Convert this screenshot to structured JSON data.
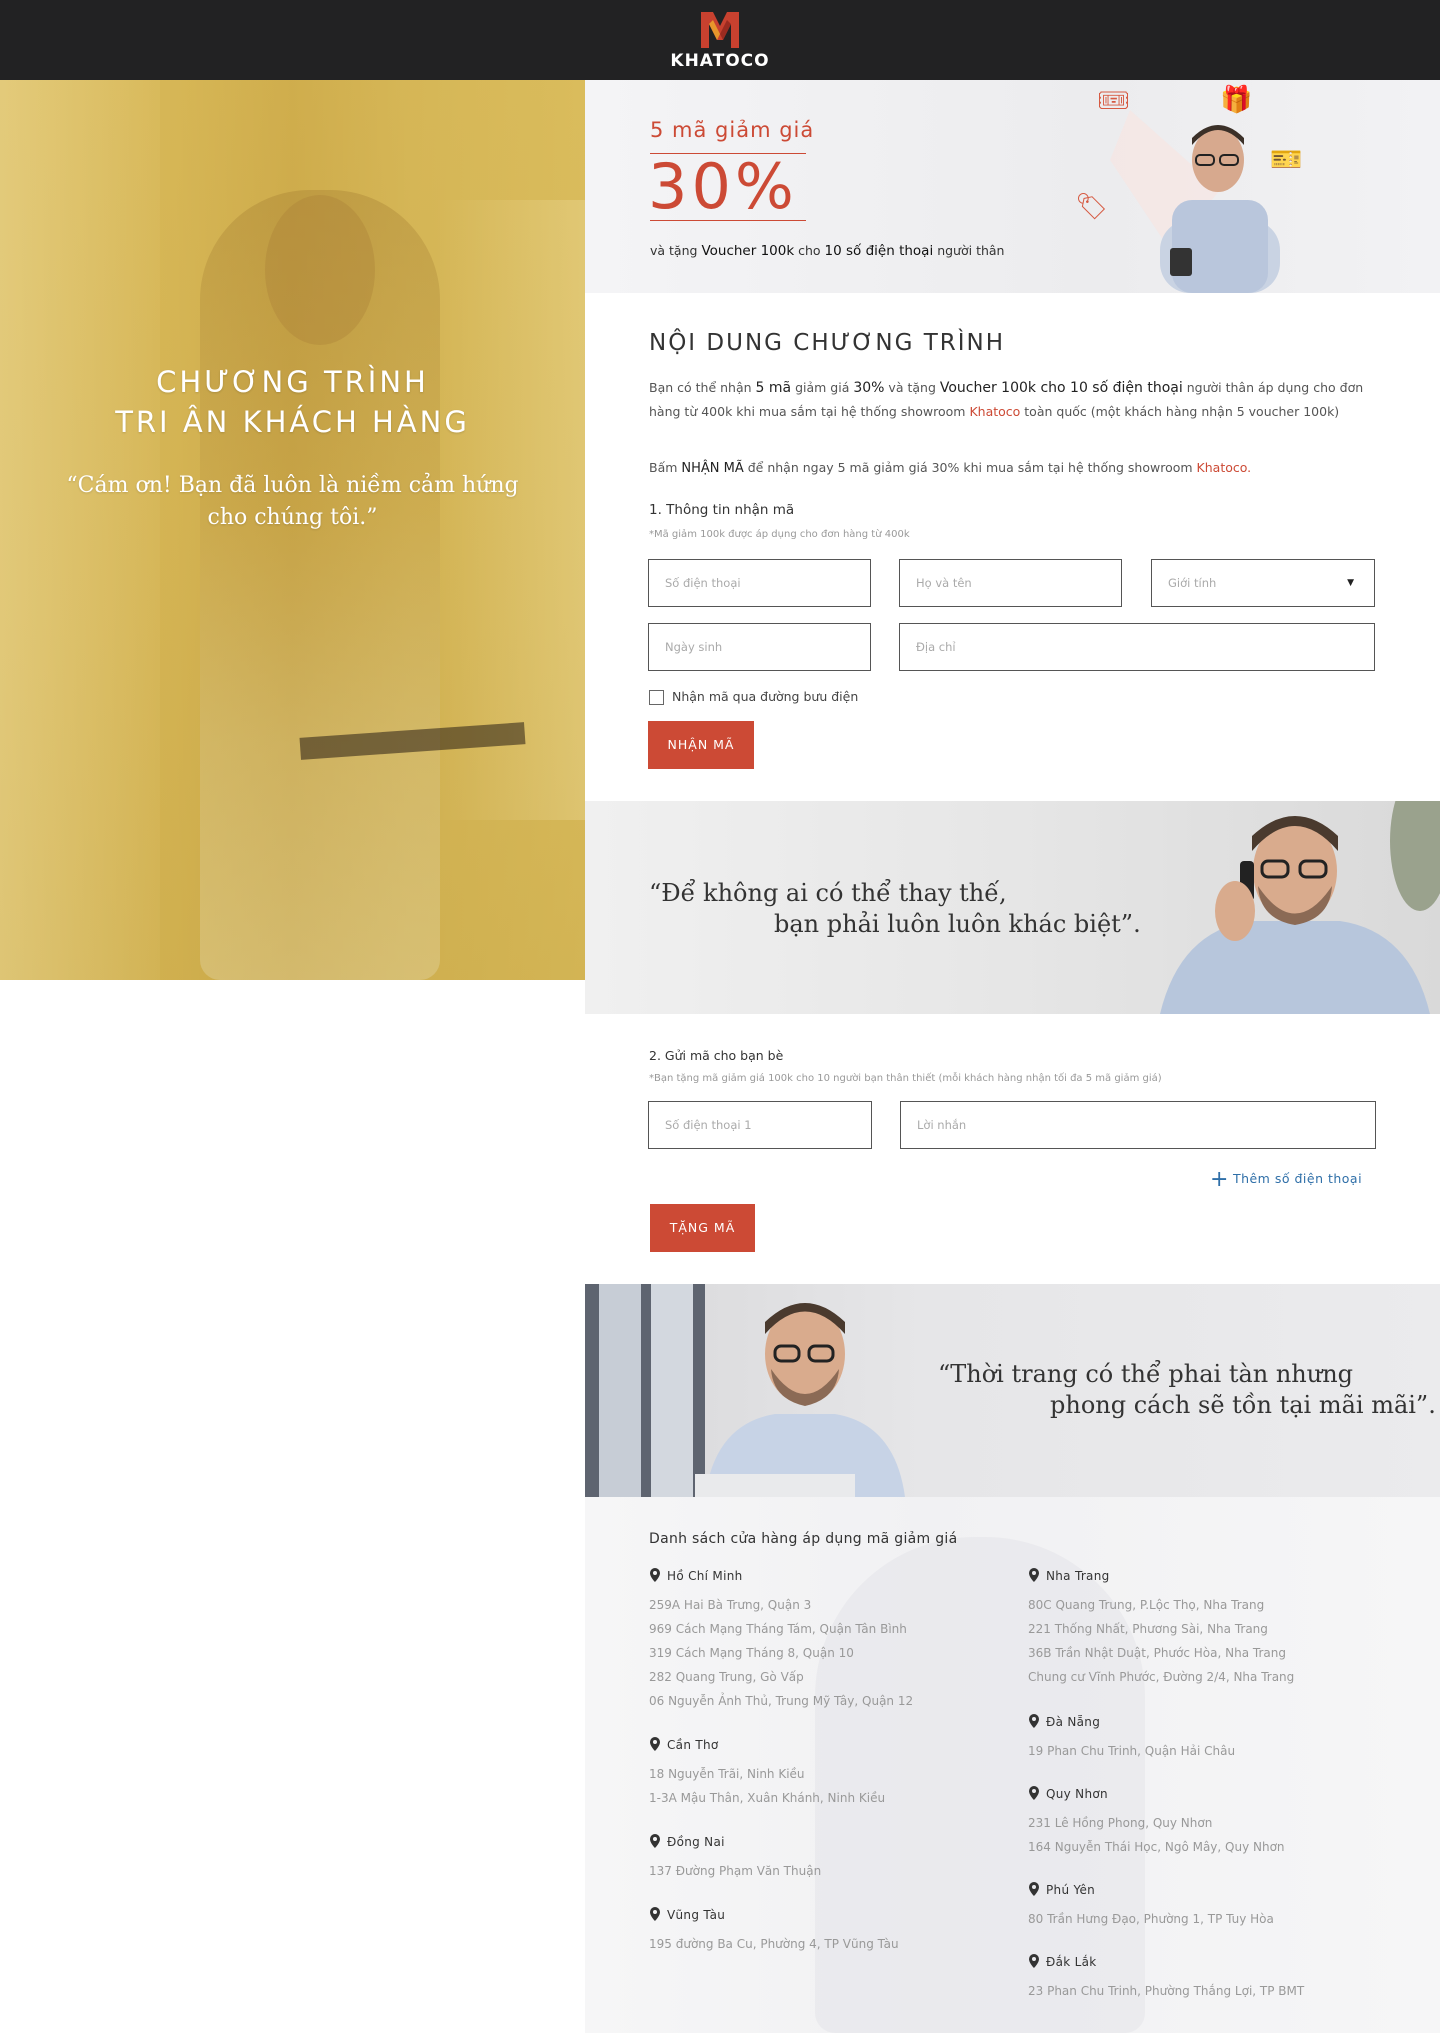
{
  "header": {
    "brand": "KHATOCO"
  },
  "hero": {
    "title_line1": "CHƯƠNG TRÌNH",
    "title_line2": "TRI ÂN KHÁCH HÀNG",
    "quote_line1": "“Cám ơn! Bạn đã luôn là niềm cảm hứng",
    "quote_line2": "cho chúng tôi.”"
  },
  "promo": {
    "small": "5 mã giảm giá",
    "big": "30%",
    "sub_prefix": "và tặng ",
    "sub_bold": "Voucher 100k",
    "sub_mid": " cho ",
    "sub_bold2": "10 số điện thoại",
    "sub_suffix": " người thân"
  },
  "program": {
    "heading": "NỘI DUNG CHƯƠNG TRÌNH",
    "p1_a": "Bạn có thể nhận ",
    "p1_b": "5 mã",
    "p1_c": " giảm giá ",
    "p1_d": "30%",
    "p1_e": " và tặng ",
    "p1_f": "Voucher 100k cho 10 số điện thoại",
    "p1_g": " người thân áp dụng cho đơn hàng từ 400k khi mua sắm tại hệ thống showroom ",
    "p1_h": "Khatoco",
    "p1_i": " toàn quốc (một khách hàng nhận 5 voucher 100k)",
    "p2_a": "Bấm ",
    "p2_b": "NHẬN MÃ",
    "p2_c": " để nhận ngay 5 mã giảm giá 30% khi mua sắm tại hệ thống showroom ",
    "p2_d": "Khatoco."
  },
  "form1": {
    "heading": "1. Thông tin nhận mã",
    "note": "*Mã giảm 100k được áp dụng cho đơn hàng từ 400k",
    "phone_placeholder": "Số điện thoại",
    "name_placeholder": "Họ và tên",
    "gender_selected": "Giới tính",
    "dob_placeholder": "Ngày sinh",
    "address_placeholder": "Địa chỉ",
    "checkbox_label": "Nhận mã qua đường bưu điện",
    "submit": "NHẬN MÃ"
  },
  "quote1": {
    "line1": "“Để không ai có thể thay thế,",
    "line2": "bạn phải luôn luôn khác biệt”."
  },
  "form2": {
    "heading": "2. Gửi mã cho bạn bè",
    "note": "*Bạn tặng mã giảm giá 100k cho 10 người bạn thân thiết (mỗi khách hàng nhận tối đa 5 mã giảm giá)",
    "phone_placeholder": "Số điện thoại 1",
    "message_placeholder": "Lời nhắn",
    "add_more": "Thêm số điện thoại",
    "submit": "TẶNG MÃ"
  },
  "quote2": {
    "line1": "“Thời trang có thể phai tàn nhưng",
    "line2": "phong cách sẽ tồn tại mãi mãi”."
  },
  "stores": {
    "heading": "Danh sách cửa hàng áp dụng mã giảm giá",
    "left": [
      {
        "city": "Hồ Chí Minh",
        "addresses": [
          "259A Hai Bà Trưng, Quận 3",
          "969 Cách Mạng Tháng Tám, Quận Tân Bình",
          "319 Cách Mạng Tháng 8, Quận 10",
          "282 Quang Trung, Gò Vấp",
          "06 Nguyễn Ảnh Thủ, Trung Mỹ Tây, Quận 12"
        ]
      },
      {
        "city": "Cần Thơ",
        "addresses": [
          "18 Nguyễn Trãi, Ninh Kiều",
          "1-3A Mậu Thân, Xuân Khánh, Ninh Kiều"
        ]
      },
      {
        "city": "Đồng Nai",
        "addresses": [
          "137 Đường Phạm Văn Thuận"
        ]
      },
      {
        "city": "Vũng Tàu",
        "addresses": [
          "195 đường Ba Cu, Phường 4, TP Vũng Tàu"
        ]
      }
    ],
    "right": [
      {
        "city": "Nha Trang",
        "addresses": [
          "80C Quang Trung, P.Lộc Thọ, Nha Trang",
          "221 Thống Nhất, Phương Sài, Nha Trang",
          "36B Trần Nhật Duật, Phước Hòa, Nha Trang",
          "Chung cư Vĩnh Phước, Đường 2/4, Nha Trang"
        ]
      },
      {
        "city": "Đà Nẵng",
        "addresses": [
          "19 Phan Chu Trinh, Quận Hải Châu"
        ]
      },
      {
        "city": "Quy Nhơn",
        "addresses": [
          "231 Lê Hồng Phong, Quy Nhơn",
          "164 Nguyễn Thái Học, Ngô Mây, Quy Nhơn"
        ]
      },
      {
        "city": "Phú Yên",
        "addresses": [
          "80 Trần Hưng Đạo, Phường 1, TP Tuy Hòa"
        ]
      },
      {
        "city": "Đắk Lắk",
        "addresses": [
          "23 Phan Chu Trinh, Phường Thắng Lợi, TP BMT"
        ]
      }
    ]
  },
  "colors": {
    "accent": "#cc4a35",
    "header_bg": "#222223",
    "hero_overlay": "#d4b04e",
    "link": "#2f6fa8"
  }
}
